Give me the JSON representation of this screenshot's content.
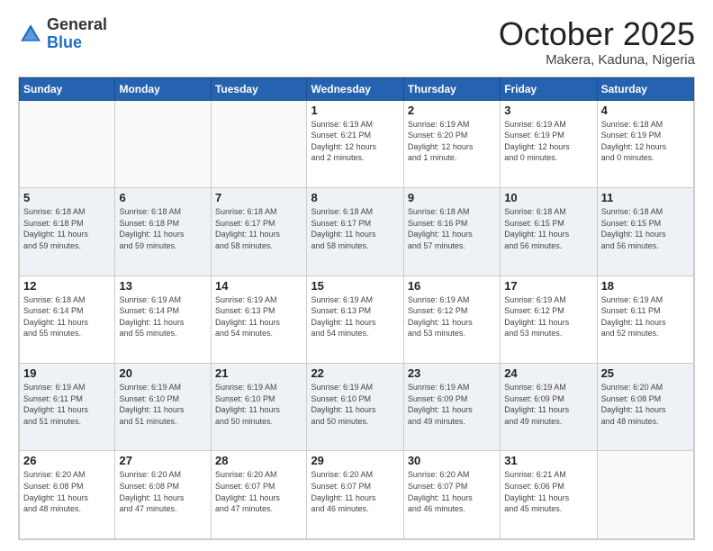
{
  "header": {
    "logo_general": "General",
    "logo_blue": "Blue",
    "title": "October 2025",
    "location": "Makera, Kaduna, Nigeria"
  },
  "weekdays": [
    "Sunday",
    "Monday",
    "Tuesday",
    "Wednesday",
    "Thursday",
    "Friday",
    "Saturday"
  ],
  "weeks": [
    [
      {
        "day": "",
        "info": ""
      },
      {
        "day": "",
        "info": ""
      },
      {
        "day": "",
        "info": ""
      },
      {
        "day": "1",
        "info": "Sunrise: 6:19 AM\nSunset: 6:21 PM\nDaylight: 12 hours\nand 2 minutes."
      },
      {
        "day": "2",
        "info": "Sunrise: 6:19 AM\nSunset: 6:20 PM\nDaylight: 12 hours\nand 1 minute."
      },
      {
        "day": "3",
        "info": "Sunrise: 6:19 AM\nSunset: 6:19 PM\nDaylight: 12 hours\nand 0 minutes."
      },
      {
        "day": "4",
        "info": "Sunrise: 6:18 AM\nSunset: 6:19 PM\nDaylight: 12 hours\nand 0 minutes."
      }
    ],
    [
      {
        "day": "5",
        "info": "Sunrise: 6:18 AM\nSunset: 6:18 PM\nDaylight: 11 hours\nand 59 minutes."
      },
      {
        "day": "6",
        "info": "Sunrise: 6:18 AM\nSunset: 6:18 PM\nDaylight: 11 hours\nand 59 minutes."
      },
      {
        "day": "7",
        "info": "Sunrise: 6:18 AM\nSunset: 6:17 PM\nDaylight: 11 hours\nand 58 minutes."
      },
      {
        "day": "8",
        "info": "Sunrise: 6:18 AM\nSunset: 6:17 PM\nDaylight: 11 hours\nand 58 minutes."
      },
      {
        "day": "9",
        "info": "Sunrise: 6:18 AM\nSunset: 6:16 PM\nDaylight: 11 hours\nand 57 minutes."
      },
      {
        "day": "10",
        "info": "Sunrise: 6:18 AM\nSunset: 6:15 PM\nDaylight: 11 hours\nand 56 minutes."
      },
      {
        "day": "11",
        "info": "Sunrise: 6:18 AM\nSunset: 6:15 PM\nDaylight: 11 hours\nand 56 minutes."
      }
    ],
    [
      {
        "day": "12",
        "info": "Sunrise: 6:18 AM\nSunset: 6:14 PM\nDaylight: 11 hours\nand 55 minutes."
      },
      {
        "day": "13",
        "info": "Sunrise: 6:19 AM\nSunset: 6:14 PM\nDaylight: 11 hours\nand 55 minutes."
      },
      {
        "day": "14",
        "info": "Sunrise: 6:19 AM\nSunset: 6:13 PM\nDaylight: 11 hours\nand 54 minutes."
      },
      {
        "day": "15",
        "info": "Sunrise: 6:19 AM\nSunset: 6:13 PM\nDaylight: 11 hours\nand 54 minutes."
      },
      {
        "day": "16",
        "info": "Sunrise: 6:19 AM\nSunset: 6:12 PM\nDaylight: 11 hours\nand 53 minutes."
      },
      {
        "day": "17",
        "info": "Sunrise: 6:19 AM\nSunset: 6:12 PM\nDaylight: 11 hours\nand 53 minutes."
      },
      {
        "day": "18",
        "info": "Sunrise: 6:19 AM\nSunset: 6:11 PM\nDaylight: 11 hours\nand 52 minutes."
      }
    ],
    [
      {
        "day": "19",
        "info": "Sunrise: 6:19 AM\nSunset: 6:11 PM\nDaylight: 11 hours\nand 51 minutes."
      },
      {
        "day": "20",
        "info": "Sunrise: 6:19 AM\nSunset: 6:10 PM\nDaylight: 11 hours\nand 51 minutes."
      },
      {
        "day": "21",
        "info": "Sunrise: 6:19 AM\nSunset: 6:10 PM\nDaylight: 11 hours\nand 50 minutes."
      },
      {
        "day": "22",
        "info": "Sunrise: 6:19 AM\nSunset: 6:10 PM\nDaylight: 11 hours\nand 50 minutes."
      },
      {
        "day": "23",
        "info": "Sunrise: 6:19 AM\nSunset: 6:09 PM\nDaylight: 11 hours\nand 49 minutes."
      },
      {
        "day": "24",
        "info": "Sunrise: 6:19 AM\nSunset: 6:09 PM\nDaylight: 11 hours\nand 49 minutes."
      },
      {
        "day": "25",
        "info": "Sunrise: 6:20 AM\nSunset: 6:08 PM\nDaylight: 11 hours\nand 48 minutes."
      }
    ],
    [
      {
        "day": "26",
        "info": "Sunrise: 6:20 AM\nSunset: 6:08 PM\nDaylight: 11 hours\nand 48 minutes."
      },
      {
        "day": "27",
        "info": "Sunrise: 6:20 AM\nSunset: 6:08 PM\nDaylight: 11 hours\nand 47 minutes."
      },
      {
        "day": "28",
        "info": "Sunrise: 6:20 AM\nSunset: 6:07 PM\nDaylight: 11 hours\nand 47 minutes."
      },
      {
        "day": "29",
        "info": "Sunrise: 6:20 AM\nSunset: 6:07 PM\nDaylight: 11 hours\nand 46 minutes."
      },
      {
        "day": "30",
        "info": "Sunrise: 6:20 AM\nSunset: 6:07 PM\nDaylight: 11 hours\nand 46 minutes."
      },
      {
        "day": "31",
        "info": "Sunrise: 6:21 AM\nSunset: 6:06 PM\nDaylight: 11 hours\nand 45 minutes."
      },
      {
        "day": "",
        "info": ""
      }
    ]
  ]
}
